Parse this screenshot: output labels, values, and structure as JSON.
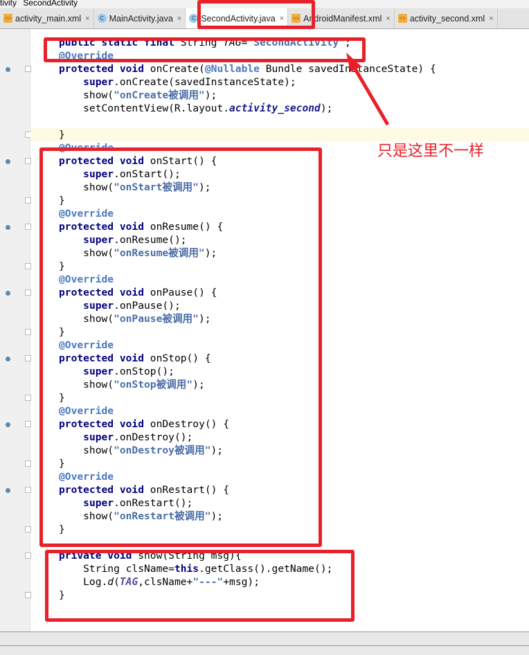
{
  "breadcrumb": [
    "tivity",
    "SecondActivity"
  ],
  "tabs": [
    {
      "label": "activity_main.xml",
      "icon": "xml-file-icon",
      "active": false
    },
    {
      "label": "MainActivity.java",
      "icon": "java-class-icon",
      "active": false
    },
    {
      "label": "SecondActivity.java",
      "icon": "java-class-icon",
      "active": true
    },
    {
      "label": "AndroidManifest.xml",
      "icon": "manifest-file-icon",
      "active": false
    },
    {
      "label": "activity_second.xml",
      "icon": "xml-file-icon",
      "active": false
    }
  ],
  "annotation_note": "只是这里不一样",
  "accent": "#e8202a",
  "code": [
    [
      [
        "public static final ",
        "kw"
      ],
      [
        "String "
      ],
      [
        "TAG",
        "it"
      ],
      [
        "="
      ],
      [
        "\"SecondActivity\"",
        "str"
      ],
      [
        ";"
      ]
    ],
    [
      [
        "@Override",
        "ann"
      ]
    ],
    [
      [
        "protected void ",
        "kw"
      ],
      [
        "onCreate("
      ],
      [
        "@Nullable",
        "ann"
      ],
      [
        " Bundle savedInstanceState) {"
      ]
    ],
    [
      [
        "    "
      ],
      [
        "super",
        "kw"
      ],
      [
        ".onCreate(savedInstanceState);"
      ]
    ],
    [
      [
        "    show("
      ],
      [
        "\"onCreate被调用\"",
        "str"
      ],
      [
        ");"
      ]
    ],
    [
      [
        "    setContentView(R.layout."
      ],
      [
        "activity_second",
        "itb"
      ],
      [
        ");"
      ]
    ],
    [
      [
        ""
      ]
    ],
    [
      [
        "}"
      ]
    ],
    [
      [
        "@Override",
        "ann"
      ]
    ],
    [
      [
        "protected void ",
        "kw"
      ],
      [
        "onStart() {"
      ]
    ],
    [
      [
        "    "
      ],
      [
        "super",
        "kw"
      ],
      [
        ".onStart();"
      ]
    ],
    [
      [
        "    show("
      ],
      [
        "\"onStart被调用\"",
        "str"
      ],
      [
        ");"
      ]
    ],
    [
      [
        "}"
      ]
    ],
    [
      [
        "@Override",
        "ann"
      ]
    ],
    [
      [
        "protected void ",
        "kw"
      ],
      [
        "onResume() {"
      ]
    ],
    [
      [
        "    "
      ],
      [
        "super",
        "kw"
      ],
      [
        ".onResume();"
      ]
    ],
    [
      [
        "    show("
      ],
      [
        "\"onResume被调用\"",
        "str"
      ],
      [
        ");"
      ]
    ],
    [
      [
        "}"
      ]
    ],
    [
      [
        "@Override",
        "ann"
      ]
    ],
    [
      [
        "protected void ",
        "kw"
      ],
      [
        "onPause() {"
      ]
    ],
    [
      [
        "    "
      ],
      [
        "super",
        "kw"
      ],
      [
        ".onPause();"
      ]
    ],
    [
      [
        "    show("
      ],
      [
        "\"onPause被调用\"",
        "str"
      ],
      [
        ");"
      ]
    ],
    [
      [
        "}"
      ]
    ],
    [
      [
        "@Override",
        "ann"
      ]
    ],
    [
      [
        "protected void ",
        "kw"
      ],
      [
        "onStop() {"
      ]
    ],
    [
      [
        "    "
      ],
      [
        "super",
        "kw"
      ],
      [
        ".onStop();"
      ]
    ],
    [
      [
        "    show("
      ],
      [
        "\"onStop被调用\"",
        "str"
      ],
      [
        ");"
      ]
    ],
    [
      [
        "}"
      ]
    ],
    [
      [
        "@Override",
        "ann"
      ]
    ],
    [
      [
        "protected void ",
        "kw"
      ],
      [
        "onDestroy() {"
      ]
    ],
    [
      [
        "    "
      ],
      [
        "super",
        "kw"
      ],
      [
        ".onDestroy();"
      ]
    ],
    [
      [
        "    show("
      ],
      [
        "\"onDestroy被调用\"",
        "str"
      ],
      [
        ");"
      ]
    ],
    [
      [
        "}"
      ]
    ],
    [
      [
        "@Override",
        "ann"
      ]
    ],
    [
      [
        "protected void ",
        "kw"
      ],
      [
        "onRestart() {"
      ]
    ],
    [
      [
        "    "
      ],
      [
        "super",
        "kw"
      ],
      [
        ".onRestart();"
      ]
    ],
    [
      [
        "    show("
      ],
      [
        "\"onRestart被调用\"",
        "str"
      ],
      [
        ");"
      ]
    ],
    [
      [
        "}"
      ]
    ],
    [
      [
        ""
      ]
    ],
    [
      [
        "private void ",
        "kw"
      ],
      [
        "show(String msg){"
      ]
    ],
    [
      [
        "    String clsName="
      ],
      [
        "this",
        "kw"
      ],
      [
        ".getClass().getName();"
      ]
    ],
    [
      [
        "    Log."
      ],
      [
        "d",
        "it"
      ],
      [
        "("
      ],
      [
        "TAG",
        "tagc"
      ],
      [
        ",clsName+"
      ],
      [
        "\"---\"",
        "str"
      ],
      [
        "+msg);"
      ]
    ],
    [
      [
        "}"
      ]
    ]
  ]
}
